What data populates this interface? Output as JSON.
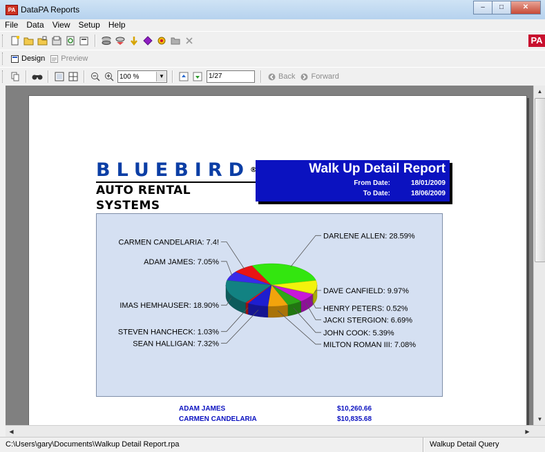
{
  "window": {
    "app_icon_text": "PA",
    "title": "DataPA Reports",
    "minimize": "–",
    "maximize": "□",
    "close": "✕"
  },
  "menu": [
    "File",
    "Data",
    "View",
    "Setup",
    "Help"
  ],
  "toolbar3": {
    "zoom": "100 %",
    "page": "1/27",
    "back": "Back",
    "forward": "Forward"
  },
  "toolbar2": {
    "design": "Design",
    "preview": "Preview"
  },
  "brand_badge": "PA",
  "report": {
    "logo_top": "BLUEBIRD",
    "logo_reg": "®",
    "logo_bottom": "AUTO RENTAL SYSTEMS",
    "title": "Walk Up Detail Report",
    "from_label": "From Date:",
    "from_value": "18/01/2009",
    "to_label": "To Date:",
    "to_value": "18/06/2009",
    "rows": [
      {
        "name": "ADAM JAMES",
        "amount": "$10,260.66"
      },
      {
        "name": "CARMEN CANDELARIA",
        "amount": "$10,835.68"
      }
    ]
  },
  "chart_data": {
    "type": "pie",
    "title": "",
    "slices": [
      {
        "label": "ADAM JAMES: 7.05%",
        "value": 7.05,
        "color": "#3a2be8"
      },
      {
        "label": "CARMEN CANDELARIA: 7.4!",
        "value": 7.45,
        "color": "#e81414"
      },
      {
        "label": "DARLENE ALLEN: 28.59%",
        "value": 28.59,
        "color": "#33e60f"
      },
      {
        "label": "DAVE CANFIELD: 9.97%",
        "value": 9.97,
        "color": "#f2f20c"
      },
      {
        "label": "HENRY PETERS: 0.52%",
        "value": 0.52,
        "color": "#e6e600"
      },
      {
        "label": "JACKI STERGION: 6.69%",
        "value": 6.69,
        "color": "#c818d8"
      },
      {
        "label": "JOHN COOK: 5.39%",
        "value": 5.39,
        "color": "#2fa818"
      },
      {
        "label": "MILTON ROMAN III: 7.08%",
        "value": 7.08,
        "color": "#f2a40c"
      },
      {
        "label": "SEAN HALLIGAN: 7.32%",
        "value": 7.32,
        "color": "#1e1ecf"
      },
      {
        "label": "STEVEN HANCHECK: 1.03%",
        "value": 1.03,
        "color": "#d81818"
      },
      {
        "label": "IMAS HEMHAUSER: 18.90%",
        "value": 18.9,
        "color": "#128282"
      }
    ]
  },
  "status": {
    "path": "C:\\Users\\gary\\Documents\\Walkup Detail Report.rpa",
    "query": "Walkup Detail Query"
  },
  "scroll": {
    "up": "▲",
    "down": "▼",
    "left": "◀",
    "right": "▶"
  }
}
